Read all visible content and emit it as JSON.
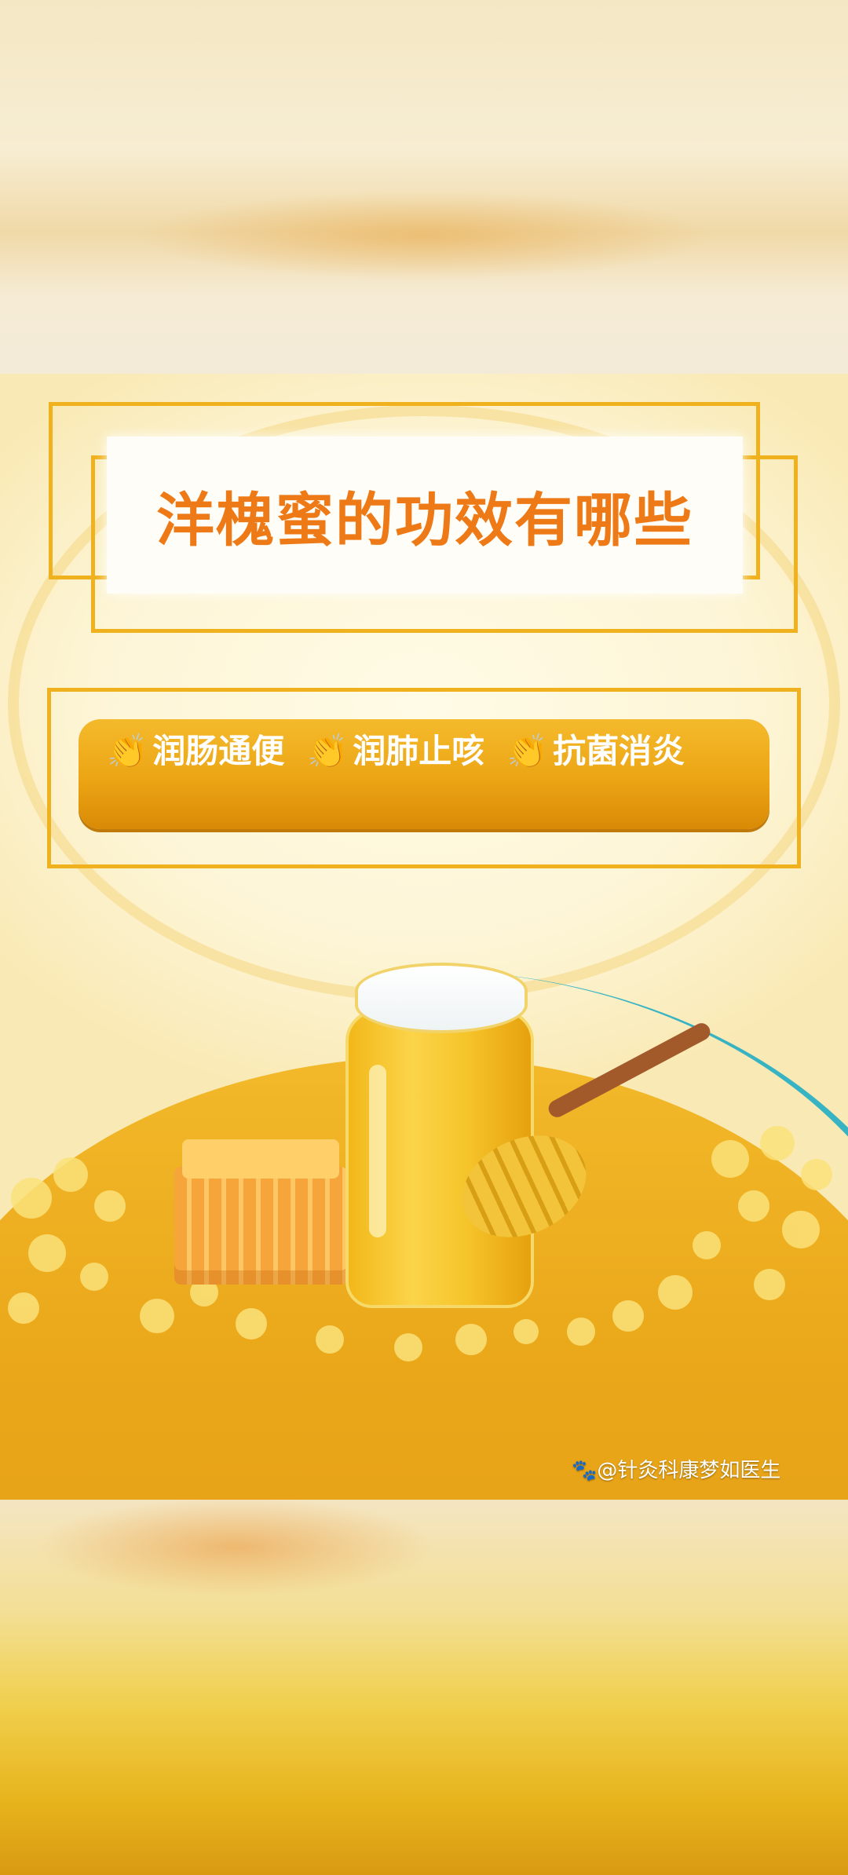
{
  "poster": {
    "title": "洋槐蜜的功效有哪些",
    "benefits": [
      "润肠通便",
      "润肺止咳",
      "抗菌消炎"
    ],
    "clap_icon": "clapping-hands-icon",
    "watermark": "@针灸科康梦如医生",
    "watermark_icon": "paw-icon"
  },
  "colors": {
    "title": "#ee7a17",
    "frame": "#f0b11e",
    "pill": "#eca514",
    "accent_arc": "#37b3c3"
  }
}
